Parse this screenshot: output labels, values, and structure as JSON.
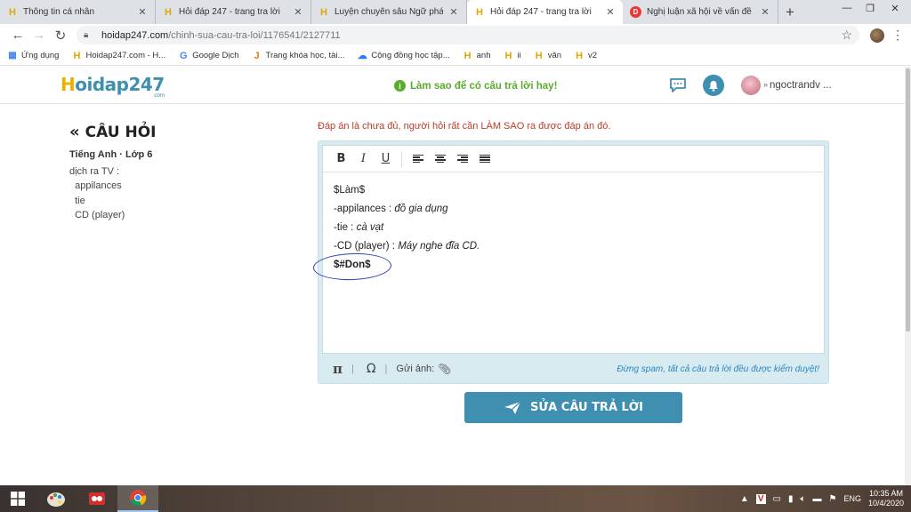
{
  "tabs": [
    {
      "title": "Thông tin cá nhân",
      "icon": "hoidap-favicon"
    },
    {
      "title": "Hỏi đáp 247 - trang tra lời",
      "icon": "hoidap-favicon"
    },
    {
      "title": "Luyện chuyên sâu Ngữ pháp và",
      "icon": "hoidap-favicon"
    },
    {
      "title": "Hỏi đáp 247 - trang tra lời",
      "icon": "hoidap-favicon",
      "active": true
    },
    {
      "title": "Nghị luận xã hội về vấn đề ô nh",
      "icon": "news-favicon"
    }
  ],
  "browser": {
    "url_host": "hoidap247.com",
    "url_path": "/chinh-sua-cau-tra-loi/1176541/2127711"
  },
  "bookmarks": [
    {
      "label": "Ứng dụng",
      "icon": "apps-icon"
    },
    {
      "label": "Hoidap247.com - H...",
      "icon": "hoidap-favicon"
    },
    {
      "label": "Google Dịch",
      "icon": "google-translate-icon"
    },
    {
      "label": "Trang khóa học, tài...",
      "icon": "j-icon"
    },
    {
      "label": "Cộng đồng học tập...",
      "icon": "cloud-icon"
    },
    {
      "label": "anh",
      "icon": "hoidap-favicon"
    },
    {
      "label": "ii",
      "icon": "hoidap-favicon"
    },
    {
      "label": "văn",
      "icon": "hoidap-favicon"
    },
    {
      "label": "v2",
      "icon": "hoidap-favicon"
    }
  ],
  "header": {
    "logo_h": "H",
    "logo_rest": "oidap247",
    "logo_com": ".com",
    "tip": "Làm sao để có câu trả lời hay!",
    "user_name": "ngoctrandv ..."
  },
  "question": {
    "heading": "CÂU HỎI",
    "subject": "Tiếng Anh · Lớp 6",
    "body": "dịch ra TV :\n  appilances\n  tie\n  CD (player)"
  },
  "editor": {
    "warning": "Đáp án là chưa đủ, người hỏi rất cần LÀM SAO ra được đáp án đó.",
    "toolbar": {
      "bold": "B",
      "italic": "I",
      "underline": "U"
    },
    "lines": {
      "l1": "$Làm$",
      "l2_prefix": "-appilances : ",
      "l2_value": "đồ gia dụng",
      "l3_prefix": "-tie : ",
      "l3_value": "cà vạt",
      "l4_prefix": "-CD (player) : ",
      "l4_value": "Máy nghe đĩa CD.",
      "l5": "$#Don$"
    },
    "footer": {
      "pi": "π",
      "omega": "Ω",
      "attach_label": "Gửi ảnh:",
      "spam_note": "Đừng spam, tất cả câu trả lời đều được kiểm duyệt!"
    }
  },
  "submit_label": "SỬA CÂU TRẢ LỜI",
  "taskbar": {
    "lang": "ENG",
    "time": "10:35 AM",
    "date": "10/4/2020"
  },
  "colors": {
    "brand_blue": "#3e8fb0",
    "brand_yellow": "#e9b100",
    "tip_green": "#5aac2c",
    "warning_red": "#c0392b"
  }
}
